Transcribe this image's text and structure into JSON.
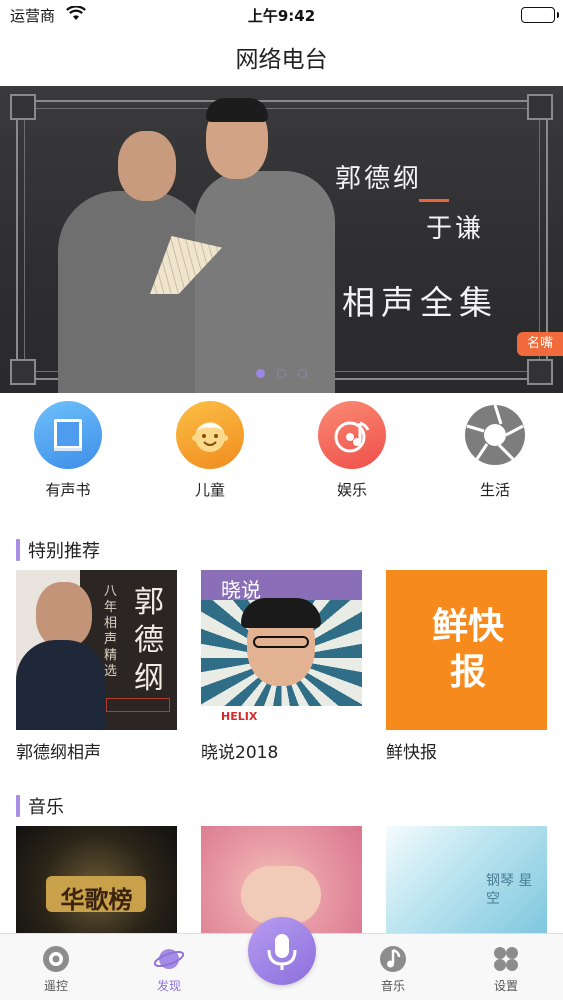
{
  "status_bar": {
    "carrier": "运营商",
    "time": "上午9:42"
  },
  "nav": {
    "title": "网络电台"
  },
  "banner": {
    "name1": "郭德纲",
    "name2": "于谦",
    "title": "相声全集",
    "badge": "名嘴",
    "page_count": 3,
    "active_page": 0
  },
  "categories": [
    {
      "label": "有声书",
      "icon": "book-icon",
      "color": "#5aa8f5"
    },
    {
      "label": "儿童",
      "icon": "child-face-icon",
      "color": "#f5a623"
    },
    {
      "label": "娱乐",
      "icon": "music-disc-icon",
      "color": "#f26b5b"
    },
    {
      "label": "生活",
      "icon": "aperture-icon",
      "color": "#8a8a8a"
    }
  ],
  "sections": {
    "featured": {
      "title": "特别推荐",
      "items": [
        {
          "caption": "郭德纲相声",
          "art_text": "郭德纲",
          "art_sub": "八年相声精选"
        },
        {
          "caption": "晓说2018",
          "art_text": "晓说",
          "art_sub": "HELIX"
        },
        {
          "caption": "鲜快报",
          "art_text": "鲜快报"
        }
      ]
    },
    "music": {
      "title": "音乐",
      "items": [
        {
          "art_text": "华歌榜"
        },
        {
          "art_text": ""
        },
        {
          "art_text": "钢琴 星空"
        }
      ]
    }
  },
  "tab_bar": {
    "tabs": [
      {
        "label": "遥控",
        "icon": "remote-disc-icon",
        "active": false
      },
      {
        "label": "发现",
        "icon": "planet-icon",
        "active": true
      },
      {
        "label": "音乐",
        "icon": "music-note-icon",
        "active": false
      },
      {
        "label": "设置",
        "icon": "grid-settings-icon",
        "active": false
      }
    ],
    "center_button_icon": "microphone-icon"
  },
  "colors": {
    "accent": "#9b88e2",
    "badge": "#f06a3c"
  }
}
